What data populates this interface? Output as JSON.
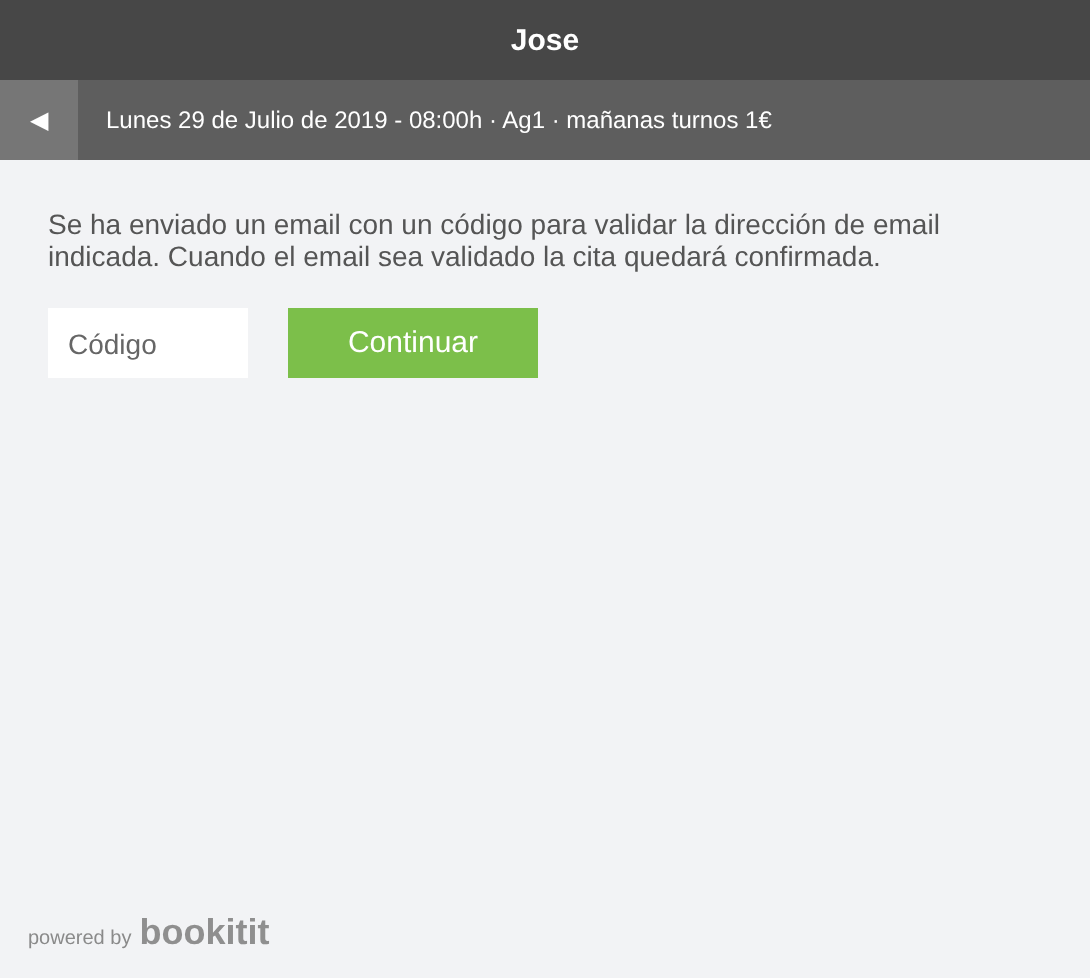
{
  "header": {
    "title": "Jose"
  },
  "subheader": {
    "back": "◀",
    "summary": "Lunes 29 de Julio de 2019 - 08:00h · Ag1 · mañanas turnos 1€"
  },
  "message": "Se ha enviado un email con un código para validar la dirección de email indicada. Cuando el email sea validado la cita quedará confirmada.",
  "code_field": {
    "placeholder": "Código"
  },
  "buttons": [
    "Continuar"
  ],
  "footer": {
    "powered": "powered by",
    "brand": "bookitit"
  }
}
